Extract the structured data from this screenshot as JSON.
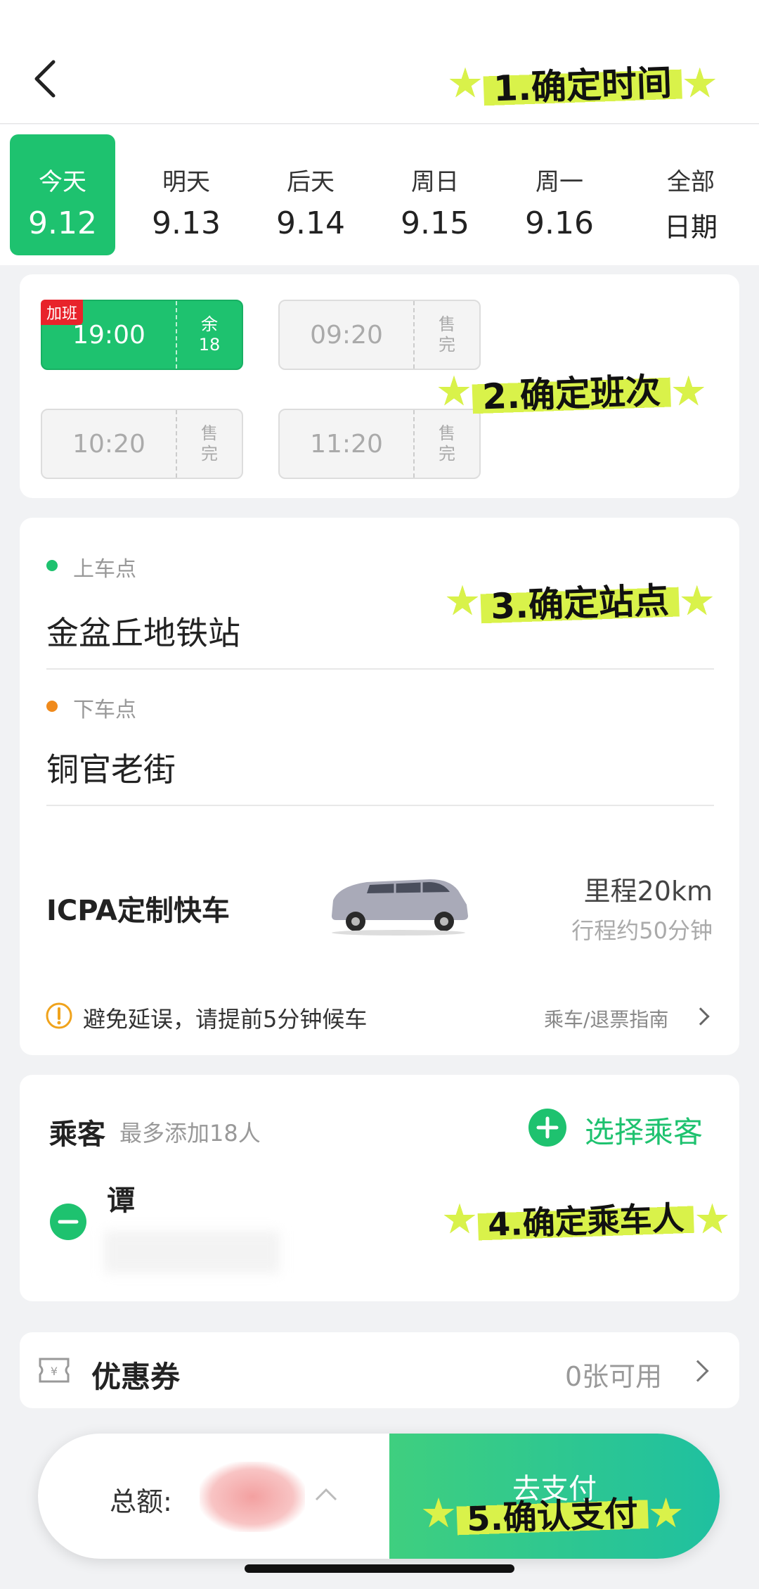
{
  "dates": [
    {
      "day": "今天",
      "date": "9.12",
      "active": true
    },
    {
      "day": "明天",
      "date": "9.13"
    },
    {
      "day": "后天",
      "date": "9.14"
    },
    {
      "day": "周日",
      "date": "9.15"
    },
    {
      "day": "周一",
      "date": "9.16"
    },
    {
      "day": "全部",
      "date": "日期"
    }
  ],
  "schedules": [
    {
      "time": "19:00",
      "r1": "余",
      "r2": "18",
      "tag": "加班",
      "active": true
    },
    {
      "time": "09:20",
      "r1": "售",
      "r2": "完"
    },
    {
      "time": "10:20",
      "r1": "售",
      "r2": "完"
    },
    {
      "time": "11:20",
      "r1": "售",
      "r2": "完"
    }
  ],
  "route": {
    "board_label": "上车点",
    "board_name": "金盆丘地铁站",
    "alight_label": "下车点",
    "alight_name": "铜官老街",
    "service_name": "ICPA定制快车",
    "distance": "里程20km",
    "duration": "行程约50分钟",
    "notice": "避免延误，请提前5分钟候车",
    "guide": "乘车/退票指南"
  },
  "passenger": {
    "title": "乘客",
    "limit": "最多添加18人",
    "select": "选择乘客",
    "name": "谭"
  },
  "coupon": {
    "title": "优惠券",
    "count": "0张可用"
  },
  "pay": {
    "total_label": "总额:",
    "button": "去支付"
  },
  "annotations": {
    "a1": "1.确定时间",
    "a2": "2.确定班次",
    "a3": "3.确定站点",
    "a4": "4.确定乘车人",
    "a5": "5.确认支付"
  },
  "colors": {
    "accent": "#1ec26f",
    "highlighter": "#d9f24a",
    "sold_out": "#aaaaaa",
    "tag": "#e8232b"
  }
}
